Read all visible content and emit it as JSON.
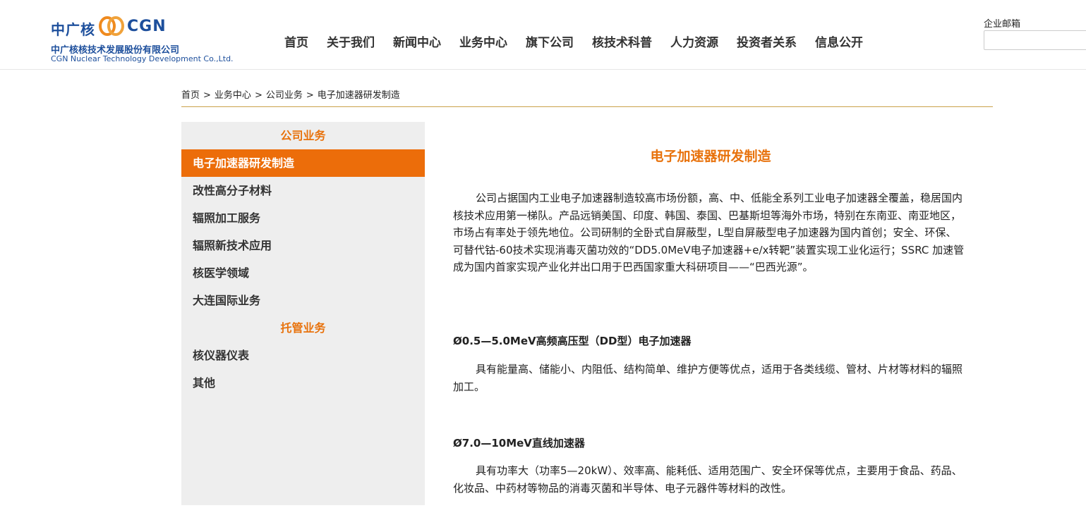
{
  "header": {
    "logo": {
      "brand_cn": "中广核",
      "brand_en": "CGN",
      "company_cn": "中广核核技术发展股份有限公司",
      "company_en": "CGN Nuclear Technology Development Co.,Ltd."
    },
    "nav": [
      "首页",
      "关于我们",
      "新闻中心",
      "业务中心",
      "旗下公司",
      "核技术科普",
      "人力资源",
      "投资者关系",
      "信息公开"
    ],
    "mail_label": "企业邮箱",
    "mail_placeholder": ""
  },
  "breadcrumb": [
    "首页",
    "业务中心",
    "公司业务",
    "电子加速器研发制造"
  ],
  "breadcrumb_separator": ">",
  "sidebar": {
    "group1_title": "公司业务",
    "group1_items": [
      "电子加速器研发制造",
      "改性高分子材料",
      "辐照加工服务",
      "辐照新技术应用",
      "核医学领域",
      "大连国际业务"
    ],
    "group2_title": "托管业务",
    "group2_items": [
      "核仪器仪表",
      "其他"
    ],
    "active_item": "电子加速器研发制造"
  },
  "content": {
    "title": "电子加速器研发制造",
    "intro": "公司占据国内工业电子加速器制造较高市场份额，高、中、低能全系列工业电子加速器全覆盖，稳居国内核技术应用第一梯队。产品远销美国、印度、韩国、泰国、巴基斯坦等海外市场，特别在东南亚、南亚地区，市场占有率处于领先地位。公司研制的全卧式自屏蔽型，L型自屏蔽型电子加速器为国内首创；安全、环保、可替代钴-60技术实现消毒灭菌功效的“DD5.0MeV电子加速器+e/x转靶”装置实现工业化运行；SSRC 加速管成为国内首家实现产业化并出口用于巴西国家重大科研项目——“巴西光源”。",
    "section1_title": "Ø0.5—5.0MeV高频高压型（DD型）电子加速器",
    "section1_text": "具有能量高、储能小、内阻低、结构简单、维护方便等优点，适用于各类线缆、管材、片材等材料的辐照加工。",
    "section2_title": "Ø7.0—10MeV直线加速器",
    "section2_text": "具有功率大（功率5—20kW）、效率高、能耗低、适用范围广、安全环保等优点，主要用于食品、药品、化妆品、中药材等物品的消毒灭菌和半导体、电子元器件等材料的改性。"
  },
  "colors": {
    "accent_orange": "#ec6d0a",
    "brand_blue": "#1d4f9c",
    "divider_gold": "#c9a14a",
    "sidebar_bg": "#eeeeee"
  }
}
